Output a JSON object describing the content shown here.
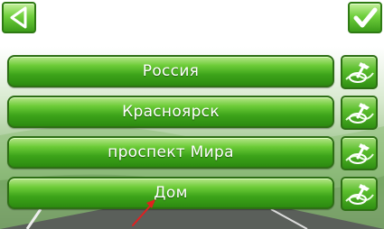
{
  "toolbar": {
    "back_icon": "triangle-left-icon",
    "confirm_icon": "checkmark-icon"
  },
  "address_rows": [
    {
      "label": "Россия",
      "pin_icon": "pushpin-map-icon"
    },
    {
      "label": "Красноярск",
      "pin_icon": "pushpin-map-icon"
    },
    {
      "label": "проспект Мира",
      "pin_icon": "pushpin-map-icon"
    },
    {
      "label": "Дом",
      "pin_icon": "pushpin-map-icon"
    }
  ],
  "annotation": {
    "icon": "red-arrow-icon",
    "color": "#e02020"
  },
  "colors": {
    "button_green": "#3da41a",
    "button_border": "#2e6f15",
    "label_text": "#ffffff"
  }
}
